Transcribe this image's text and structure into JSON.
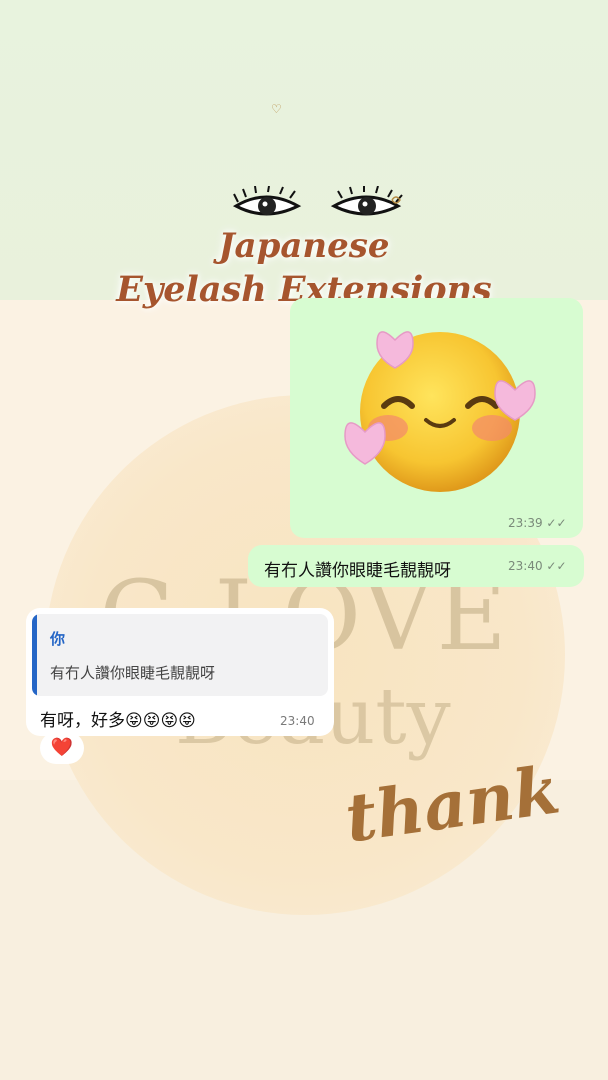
{
  "header": {
    "title_line1": "Japanese",
    "title_line2": "Eyelash Extensions"
  },
  "background": {
    "watermark_line1": "G LOVE",
    "watermark_line2": "Beauty",
    "script_text": "thank"
  },
  "messages": [
    {
      "type": "image-emoji",
      "direction": "outgoing",
      "icon": "smiling-face-with-hearts-icon",
      "time": "23:39",
      "status": "read"
    },
    {
      "type": "text",
      "direction": "outgoing",
      "text": "有冇人讚你眼睫毛靚靚呀",
      "time": "23:40",
      "status": "read"
    },
    {
      "type": "reply",
      "direction": "incoming",
      "quoted_author": "你",
      "quoted_text": "有冇人讚你眼睫毛靚靚呀",
      "text": "有呀，好多😝😝😝😝",
      "time": "23:40",
      "reaction": "❤️"
    }
  ],
  "colors": {
    "outgoing_bubble": "#d7fcd1",
    "incoming_bubble": "#ffffff",
    "quote_accent": "#2566c6",
    "title": "#a6552e"
  }
}
